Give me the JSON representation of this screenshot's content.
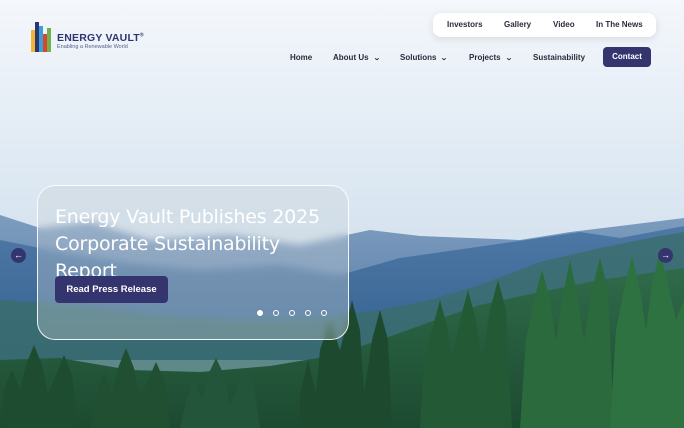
{
  "header": {
    "logo": {
      "name": "ENERGY VAULT",
      "trademark": "®",
      "tagline": "Enabling a Renewable World"
    },
    "top_nav": [
      "Investors",
      "Gallery",
      "Video",
      "In The News"
    ],
    "main_nav": {
      "home": "Home",
      "about": "About Us",
      "solutions": "Solutions",
      "projects": "Projects",
      "sustainability": "Sustainability",
      "contact": "Contact"
    },
    "chevron_glyph": "⌄"
  },
  "slider": {
    "title": "Energy Vault Publishes 2025 Corporate Sustainability Report",
    "cta": "Read Press Release",
    "slide_count": 5,
    "active_slide": 1,
    "prev_icon": "←",
    "next_icon": "→"
  },
  "colors": {
    "brand_navy": "#34356f",
    "text_dark": "#2b2b3d"
  }
}
